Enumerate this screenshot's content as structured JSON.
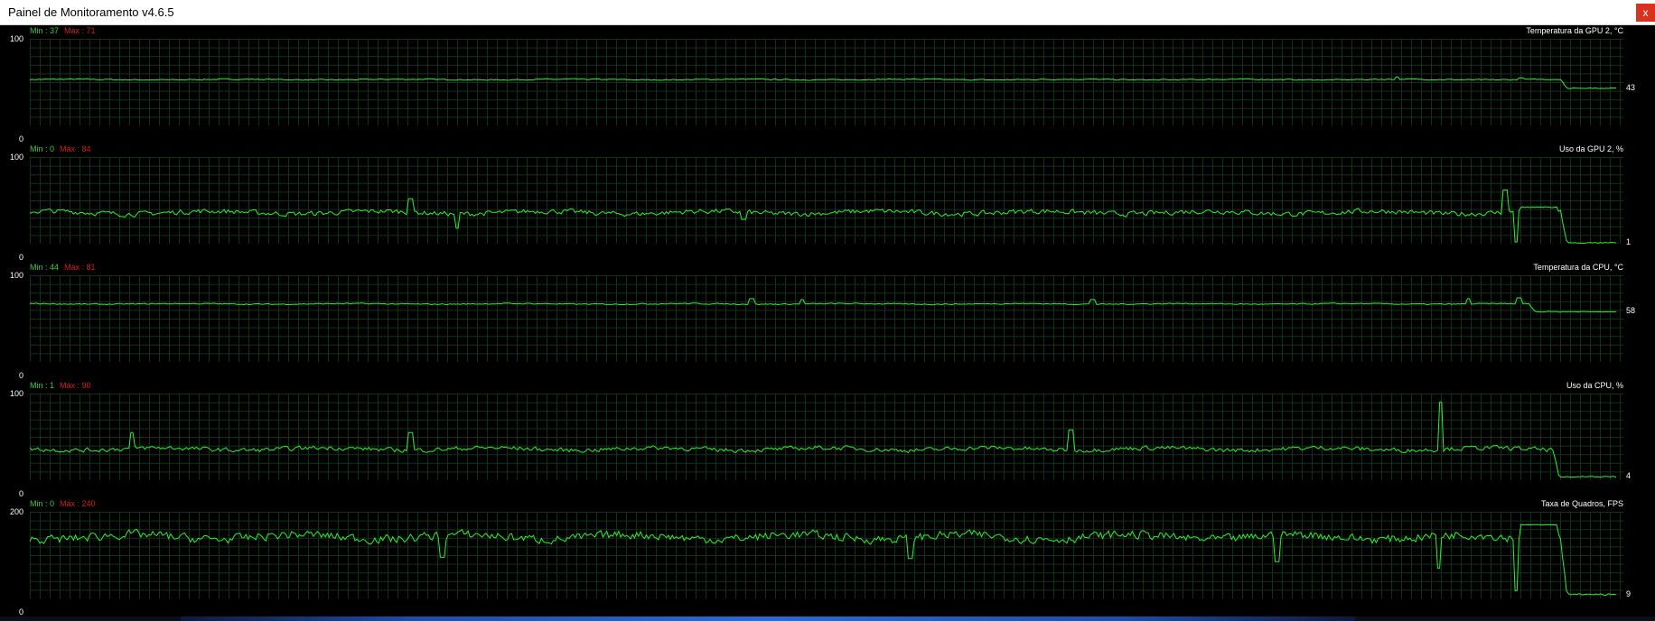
{
  "window": {
    "title": "Painel de Monitoramento v4.6.5",
    "close_label": "x"
  },
  "colors": {
    "background": "#000000",
    "grid": "#12321a",
    "line": "#2bf22b",
    "min_text": "#34d03a",
    "max_text": "#d81e1e",
    "close_button": "#d9321f"
  },
  "graphs": [
    {
      "title": "Temperatura da GPU 2, °C",
      "min_label": "Min : 37",
      "max_label": "Máx : 71",
      "y_max_label": "100",
      "y_min_label": "0",
      "current_label": "43",
      "y_range": [
        0,
        100
      ],
      "current": 43,
      "trace": {
        "base": 53,
        "noise": 0.8,
        "spikes": [
          [
            0.862,
            56
          ],
          [
            0.94,
            55
          ]
        ],
        "end_drop": {
          "from": 0.965,
          "to_value": 43
        }
      }
    },
    {
      "title": "Uso da GPU 2, %",
      "min_label": "Min : 0",
      "max_label": "Máx : 84",
      "y_max_label": "100",
      "y_min_label": "0",
      "current_label": "1",
      "y_range": [
        0,
        100
      ],
      "current": 1,
      "trace": {
        "base": 36,
        "noise": 4,
        "spikes": [
          [
            0.24,
            52
          ],
          [
            0.269,
            18
          ],
          [
            0.45,
            28
          ],
          [
            0.93,
            62
          ],
          [
            0.937,
            2
          ]
        ],
        "plateau": {
          "from": 0.94,
          "to": 0.963,
          "value": 42
        },
        "end_drop": {
          "from": 0.965,
          "to_value": 1
        }
      }
    },
    {
      "title": "Temperatura da CPU, °C",
      "min_label": "Min : 44",
      "max_label": "Máx : 81",
      "y_max_label": "100",
      "y_min_label": "0",
      "current_label": "58",
      "y_range": [
        0,
        100
      ],
      "current": 58,
      "trace": {
        "base": 67,
        "noise": 0.9,
        "spikes": [
          [
            0.455,
            73
          ],
          [
            0.487,
            72
          ],
          [
            0.67,
            72
          ],
          [
            0.907,
            73
          ],
          [
            0.939,
            74
          ]
        ],
        "end_drop": {
          "from": 0.945,
          "to_value": 58
        }
      }
    },
    {
      "title": "Uso da CPU, %",
      "min_label": "Min : 1",
      "max_label": "Máx : 90",
      "y_max_label": "100",
      "y_min_label": "0",
      "current_label": "4",
      "y_range": [
        0,
        100
      ],
      "current": 4,
      "trace": {
        "base": 36,
        "noise": 3.5,
        "spikes": [
          [
            0.064,
            55
          ],
          [
            0.24,
            55
          ],
          [
            0.656,
            58
          ],
          [
            0.889,
            90
          ]
        ],
        "end_drop": {
          "from": 0.96,
          "to_value": 4
        }
      }
    },
    {
      "title": "Taxa de Quadros, FPS",
      "min_label": "Min : 0",
      "max_label": "Máx : 240",
      "y_max_label": "200",
      "y_min_label": "0",
      "current_label": "9",
      "y_range": [
        0,
        200
      ],
      "current": 9,
      "trace": {
        "base": 142,
        "noise": 14,
        "spikes": [
          [
            0.26,
            95
          ],
          [
            0.555,
            92
          ],
          [
            0.786,
            85
          ],
          [
            0.888,
            70
          ],
          [
            0.937,
            18
          ]
        ],
        "plateau": {
          "from": 0.94,
          "to": 0.963,
          "value": 170
        },
        "end_drop": {
          "from": 0.965,
          "to_value": 9
        }
      }
    }
  ]
}
